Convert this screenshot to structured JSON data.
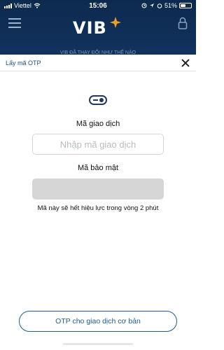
{
  "status_bar": {
    "carrier": "Viettel",
    "time": "15:06",
    "battery": "51%",
    "battery_level": 0.51
  },
  "app_header": {
    "logo_text": "VIB",
    "subtitle": "VIB ĐÃ THAY ĐỔI NHƯ THẾ NÀO"
  },
  "sheet": {
    "title": "Lấy mã OTP",
    "transaction_code_label": "Mã giao dịch",
    "transaction_code_placeholder": "Nhập mã giao dịch",
    "transaction_code_value": "",
    "security_code_label": "Mã bảo mật",
    "security_code_value": "",
    "validity_note": "Mã này sẽ hết hiệu lực trong vòng 2 phút",
    "basic_otp_button": "OTP cho giao dịch cơ bản"
  },
  "icons": [
    "signal-icon",
    "wifi-icon",
    "menu-icon",
    "lock-icon",
    "otp-key-icon",
    "close-icon",
    "location-icon",
    "alarm-icon"
  ],
  "colors": {
    "primary": "#1c5b94",
    "app_background": "#133563",
    "field_disabled": "#d6d6d6"
  }
}
